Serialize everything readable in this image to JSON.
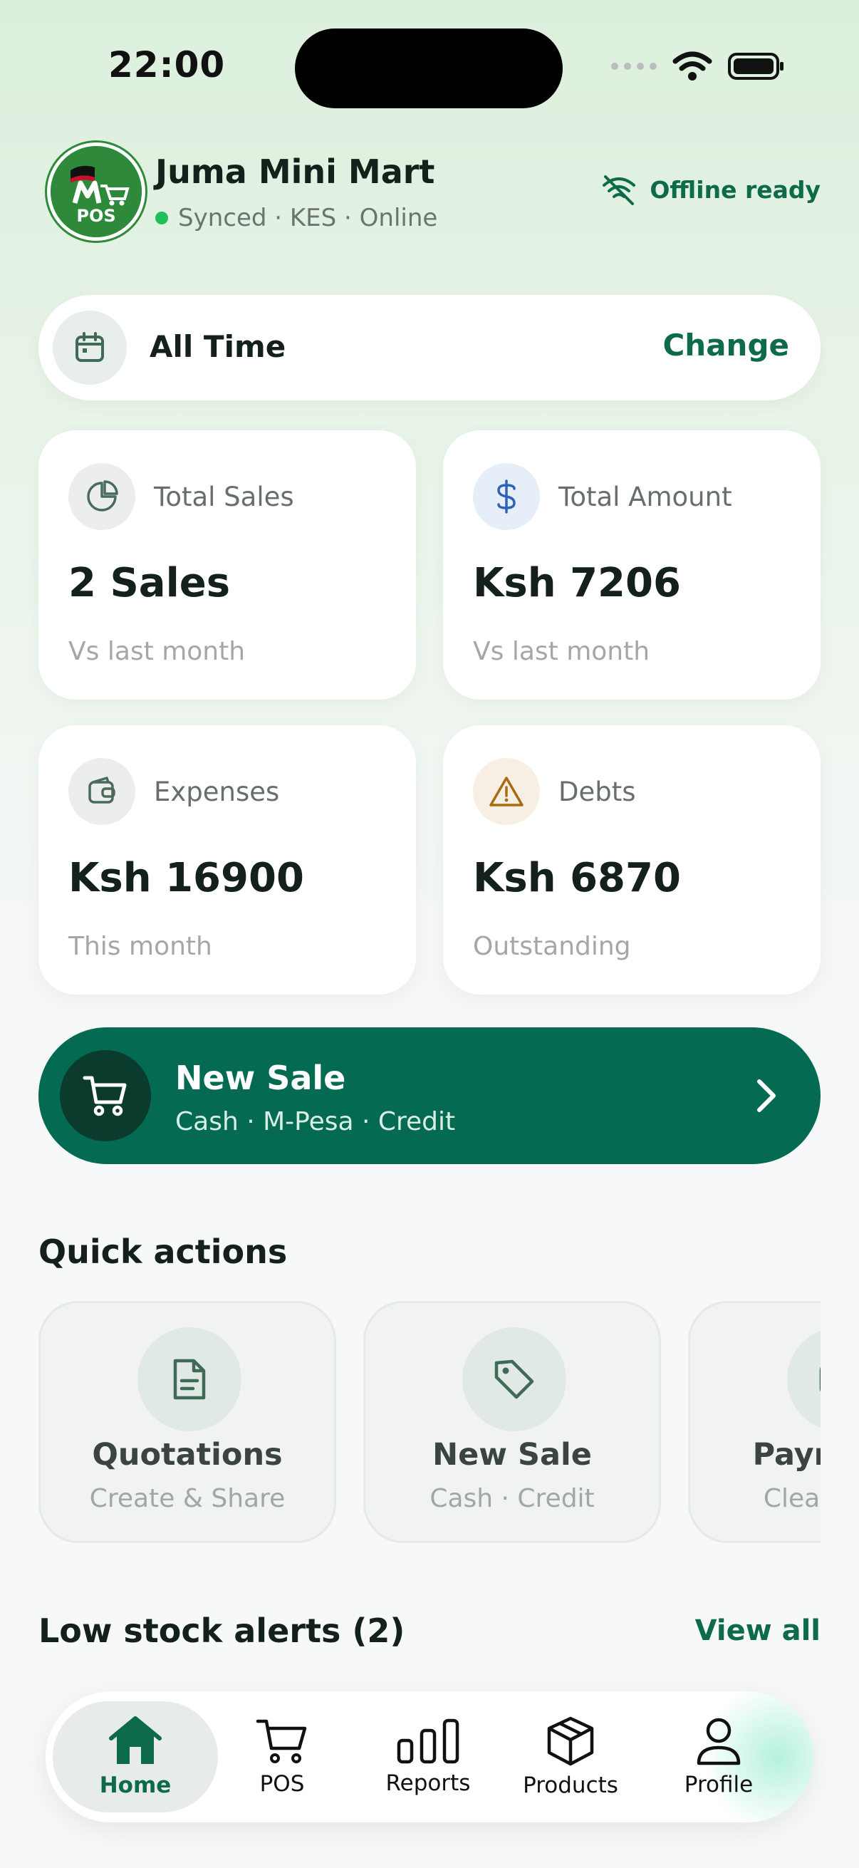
{
  "status_bar": {
    "time": "22:00"
  },
  "header": {
    "logo_text": "POS",
    "store_name": "Juma Mini Mart",
    "status_text": "Synced · KES · Online",
    "offline_label": "Offline ready"
  },
  "period": {
    "label": "All Time",
    "change_label": "Change"
  },
  "stats": [
    {
      "label": "Total Sales",
      "value": "2 Sales",
      "sub": "Vs last month",
      "icon": "pie-chart-icon"
    },
    {
      "label": "Total Amount",
      "value": "Ksh 7206",
      "sub": "Vs last month",
      "icon": "dollar-icon"
    },
    {
      "label": "Expenses",
      "value": "Ksh 16900",
      "sub": "This month",
      "icon": "wallet-icon"
    },
    {
      "label": "Debts",
      "value": "Ksh 6870",
      "sub": "Outstanding",
      "icon": "warning-icon"
    }
  ],
  "new_sale_banner": {
    "title": "New Sale",
    "subtitle": "Cash · M-Pesa · Credit"
  },
  "quick_actions": {
    "title": "Quick actions",
    "items": [
      {
        "title": "Quotations",
        "subtitle": "Create & Share",
        "icon": "document-icon"
      },
      {
        "title": "New Sale",
        "subtitle": "Cash · Credit",
        "icon": "tag-icon"
      },
      {
        "title": "Payments",
        "subtitle": "Clear debts",
        "icon": "card-icon"
      }
    ]
  },
  "low_stock": {
    "title": "Low stock alerts (2)",
    "view_all": "View all"
  },
  "nav": {
    "items": [
      {
        "label": "Home",
        "active": true
      },
      {
        "label": "POS"
      },
      {
        "label": "Reports"
      },
      {
        "label": "Products"
      },
      {
        "label": "Profile"
      }
    ]
  },
  "colors": {
    "brand": "#046a51",
    "accent_text": "#0e6b4a",
    "online": "#1fbf5a"
  }
}
